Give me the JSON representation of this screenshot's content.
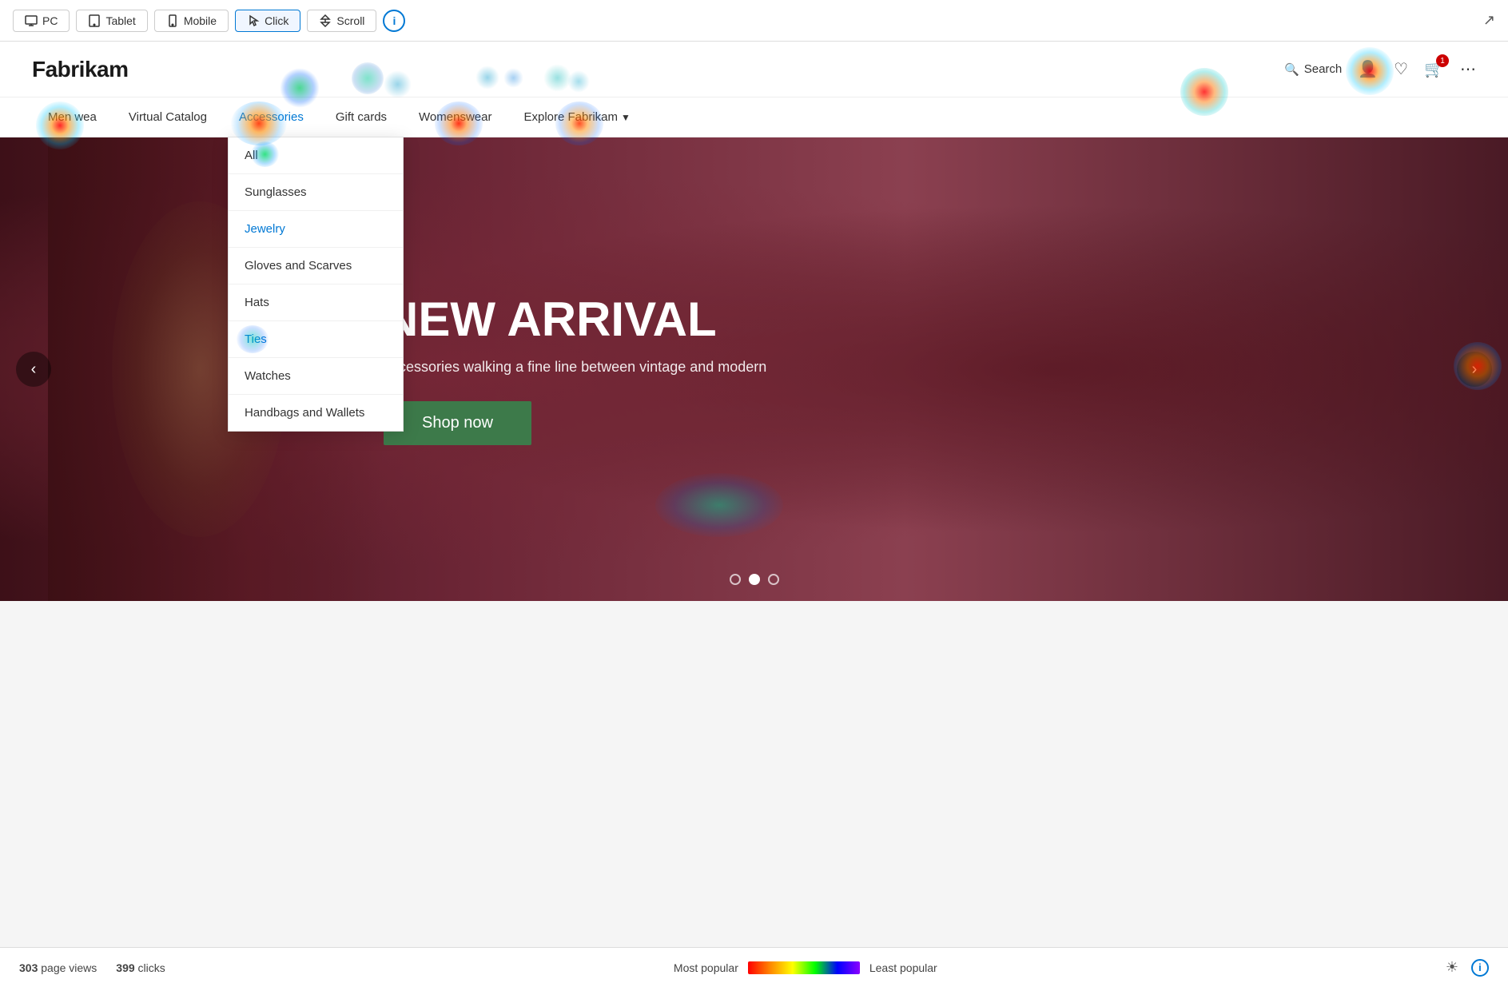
{
  "toolbar": {
    "pc_label": "PC",
    "tablet_label": "Tablet",
    "mobile_label": "Mobile",
    "click_label": "Click",
    "scroll_label": "Scroll",
    "info_label": "i"
  },
  "header": {
    "logo": "Fabrikam",
    "search_label": "Search",
    "cart_count": "1"
  },
  "nav": {
    "items": [
      {
        "label": "Men wea",
        "url": "#",
        "highlighted": false
      },
      {
        "label": "Virtual Catalog",
        "url": "#",
        "highlighted": false
      },
      {
        "label": "Accessories",
        "url": "#",
        "highlighted": true
      },
      {
        "label": "Gift cards",
        "url": "#",
        "highlighted": false
      },
      {
        "label": "Womenswear",
        "url": "#",
        "highlighted": false
      },
      {
        "label": "Explore Fabrikam",
        "url": "#",
        "highlighted": false,
        "hasArrow": true
      }
    ]
  },
  "dropdown": {
    "items": [
      {
        "label": "All",
        "highlighted": false
      },
      {
        "label": "Sunglasses",
        "highlighted": false
      },
      {
        "label": "Jewelry",
        "highlighted": true
      },
      {
        "label": "Gloves and Scarves",
        "highlighted": false
      },
      {
        "label": "Hats",
        "highlighted": false
      },
      {
        "label": "Ties",
        "highlighted": true
      },
      {
        "label": "Watches",
        "highlighted": false
      },
      {
        "label": "Handbags and Wallets",
        "highlighted": false
      }
    ]
  },
  "hero": {
    "title": "NEW ARRIVAL",
    "subtitle": "accessories walking a fine line between vintage and modern",
    "cta_label": "Shop now",
    "dots": [
      {
        "active": false
      },
      {
        "active": true
      },
      {
        "active": false
      }
    ]
  },
  "status": {
    "page_views_count": "303",
    "page_views_label": "page views",
    "clicks_count": "399",
    "clicks_label": "clicks",
    "most_popular": "Most popular",
    "least_popular": "Least popular"
  }
}
